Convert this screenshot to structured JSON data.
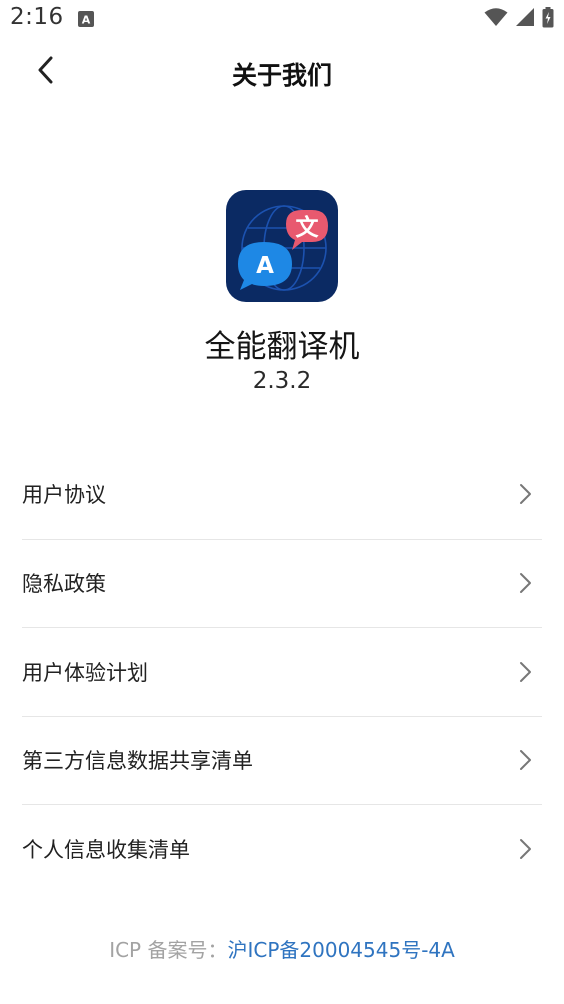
{
  "status_bar": {
    "time": "2:16",
    "icons": [
      "notification-a-icon",
      "wifi-icon",
      "signal-icon",
      "battery-icon"
    ]
  },
  "header": {
    "title": "关于我们",
    "back_icon": "chevron-left-icon"
  },
  "app": {
    "name": "全能翻译机",
    "version": "2.3.2",
    "icon_letters": {
      "left": "A",
      "right": "文"
    },
    "icon_colors": {
      "background": "#0b2a63",
      "left_bubble": "#1e88e5",
      "right_bubble": "#e8596f"
    }
  },
  "menu": {
    "items": [
      {
        "label": "用户协议"
      },
      {
        "label": "隐私政策"
      },
      {
        "label": "用户体验计划"
      },
      {
        "label": "第三方信息数据共享清单"
      },
      {
        "label": "个人信息收集清单"
      }
    ],
    "chevron_icon": "chevron-right-icon"
  },
  "footer": {
    "icp_label": "ICP 备案号：",
    "icp_number": "沪ICP备20004545号-4A"
  },
  "colors": {
    "link": "#2f74c0",
    "muted": "#a3a3a3",
    "divider": "#e6e6e6"
  }
}
